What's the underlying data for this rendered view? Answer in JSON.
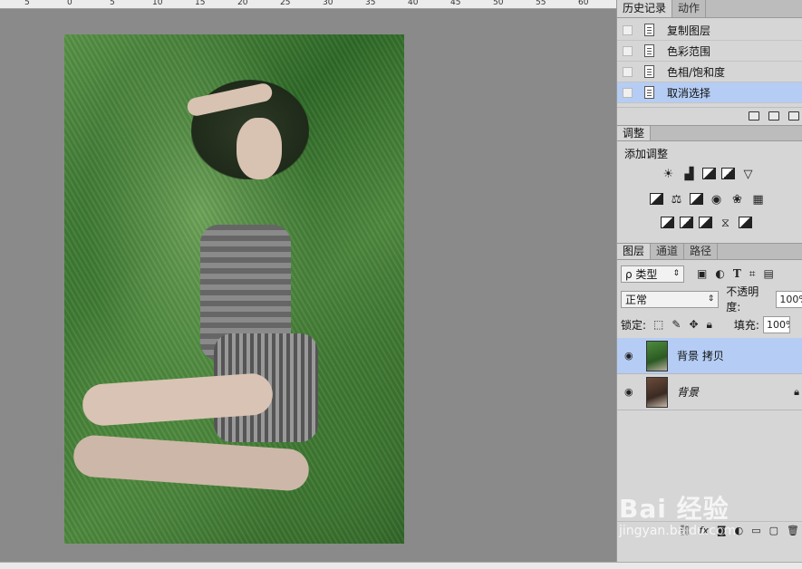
{
  "ruler": {
    "labels": [
      "5",
      "0",
      "5",
      "10",
      "15",
      "20",
      "25",
      "30",
      "35",
      "40",
      "45",
      "50",
      "55",
      "60"
    ]
  },
  "history_panel": {
    "tabs": [
      "历史记录",
      "动作"
    ],
    "items": [
      {
        "label": "复制图层",
        "selected": false
      },
      {
        "label": "色彩范围",
        "selected": false
      },
      {
        "label": "色相/饱和度",
        "selected": false
      },
      {
        "label": "取消选择",
        "selected": true
      }
    ]
  },
  "adjustments_panel": {
    "tab": "调整",
    "title": "添加调整"
  },
  "layers_panel": {
    "tabs": [
      "图层",
      "通道",
      "路径"
    ],
    "filter_label": "ρ 类型",
    "blend_mode": "正常",
    "opacity_label": "不透明度:",
    "opacity_value": "100%",
    "lock_label": "锁定:",
    "fill_label": "填充:",
    "fill_value": "100%",
    "layers": [
      {
        "name": "背景 拷贝",
        "selected": true
      },
      {
        "name": "背景",
        "selected": false
      }
    ]
  },
  "watermark": {
    "logo": "Bai 经验",
    "url": "jingyan.baidu.com"
  },
  "colors": {
    "selection": "#b5cdf4",
    "panel_bg": "#d6d6d6",
    "workspace": "#8a8a8a"
  }
}
